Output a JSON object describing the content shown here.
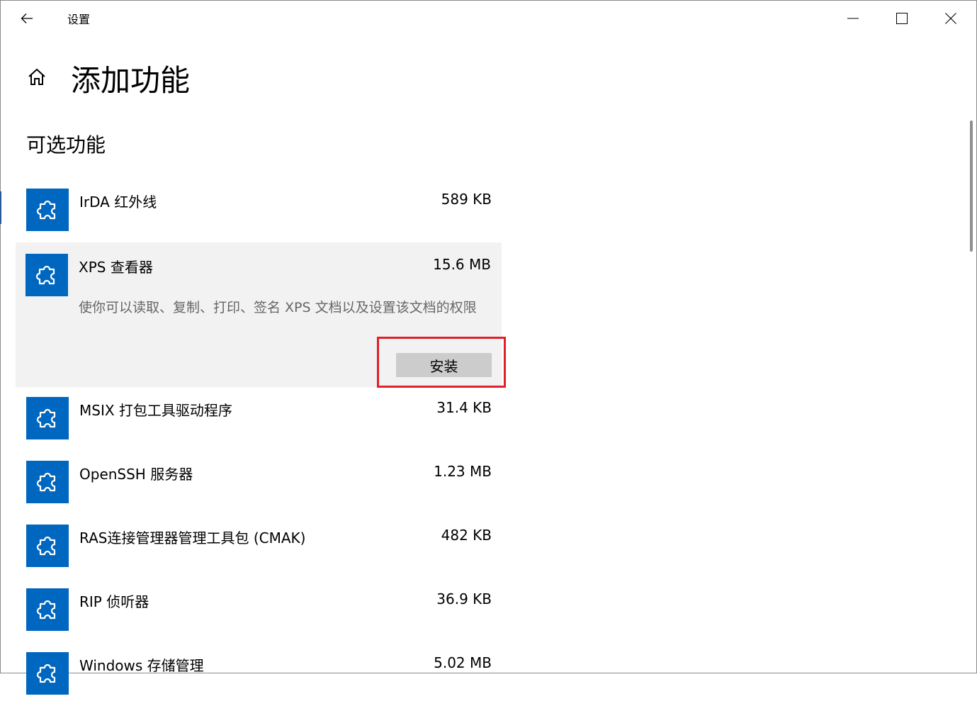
{
  "window": {
    "title": "设置",
    "back_icon": "back-arrow-icon",
    "minimize_icon": "minimize-icon",
    "maximize_icon": "maximize-icon",
    "close_icon": "close-icon"
  },
  "page": {
    "home_icon": "home-icon",
    "title": "添加功能",
    "section_title": "可选功能"
  },
  "features": [
    {
      "name": "IrDA 红外线",
      "size": "589 KB",
      "icon": "puzzle-icon"
    },
    {
      "name": "XPS 查看器",
      "size": "15.6 MB",
      "icon": "puzzle-icon",
      "description": "使你可以读取、复制、打印、签名 XPS 文档以及设置该文档的权限",
      "install_label": "安装",
      "expanded": true
    },
    {
      "name": "MSIX 打包工具驱动程序",
      "size": "31.4 KB",
      "icon": "puzzle-icon"
    },
    {
      "name": "OpenSSH 服务器",
      "size": "1.23 MB",
      "icon": "puzzle-icon"
    },
    {
      "name": "RAS连接管理器管理工具包 (CMAK)",
      "size": "482 KB",
      "icon": "puzzle-icon"
    },
    {
      "name": "RIP 侦听器",
      "size": "36.9 KB",
      "icon": "puzzle-icon"
    },
    {
      "name": "Windows 存储管理",
      "size": "5.02 MB",
      "icon": "puzzle-icon"
    }
  ],
  "colors": {
    "accent": "#0067c0",
    "expanded_bg": "#f2f2f2",
    "button_bg": "#cccccc",
    "highlight": "#e0202a"
  }
}
